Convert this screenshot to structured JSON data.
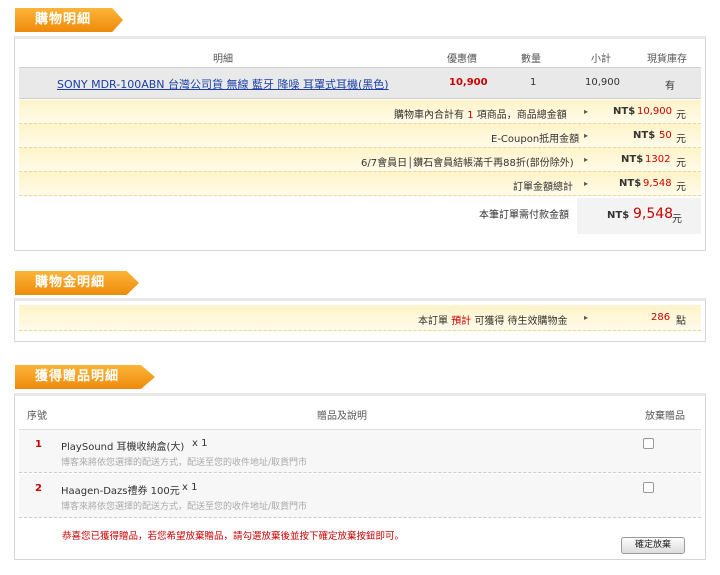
{
  "cart": {
    "title": "購物明細",
    "headers": {
      "detail": "明細",
      "discount_price": "優惠價",
      "qty": "數量",
      "subtotal": "小計",
      "stock": "現貨庫存"
    },
    "item": {
      "name": "SONY MDR-100ABN 台灣公司貨 無線 藍牙 降噪 耳罩式耳機(黑色)",
      "price": "10,900",
      "qty": "1",
      "subtotal": "10,900",
      "stock": "有"
    },
    "summary": {
      "total_pre": "購物車內合計有",
      "total_count": "1",
      "total_post": "項商品，商品總金額",
      "total_currency": "NT$",
      "total_value": "10,900",
      "total_unit": "元",
      "coupon_label": "E-Coupon抵用金額",
      "coupon_currency": "NT$",
      "coupon_value": "50",
      "coupon_unit": "元",
      "promo_label": "6/7會員日│鑽石會員結帳滿千再88折(部份除外)",
      "promo_currency": "NT$",
      "promo_value": "1302",
      "promo_unit": "元",
      "order_label": "訂單金額總計",
      "order_currency": "NT$",
      "order_value": "9,548",
      "order_unit": "元",
      "pay_label": "本筆訂單需付款金額",
      "pay_currency": "NT$",
      "pay_value": "9,548",
      "pay_unit": "元"
    }
  },
  "credit": {
    "title": "購物金明細",
    "pre": "本訂單",
    "est": "預計",
    "post": "可獲得 待生效購物金",
    "value": "286",
    "unit": "點"
  },
  "gift": {
    "title": "獲得贈品明細",
    "headers": {
      "seq": "序號",
      "desc": "贈品及說明",
      "drop": "放棄贈品"
    },
    "items": [
      {
        "seq": "1",
        "name": "PlaySound 耳機收納盒(大)",
        "qty": "x 1",
        "note": "博客來將依您選擇的配送方式，配送至您的收件地址/取貨門市"
      },
      {
        "seq": "2",
        "name": "Haagen-Dazs禮券 100元",
        "qty": "x 1",
        "note": "博客來將依您選擇的配送方式，配送至您的收件地址/取貨門市"
      }
    ],
    "notice": "恭喜您已獲得贈品，若您希望放棄贈品，請勾選放棄後並按下確定放棄按鈕即可。",
    "confirm_button": "確定放棄"
  },
  "colors": {
    "accent": "#f39b1a",
    "red": "#cc0000",
    "link": "#1a3fa8",
    "row_bg": "#fff5d0"
  },
  "icons": {
    "row_arrow": "triangle-right-icon",
    "checkbox": "checkbox-icon"
  }
}
